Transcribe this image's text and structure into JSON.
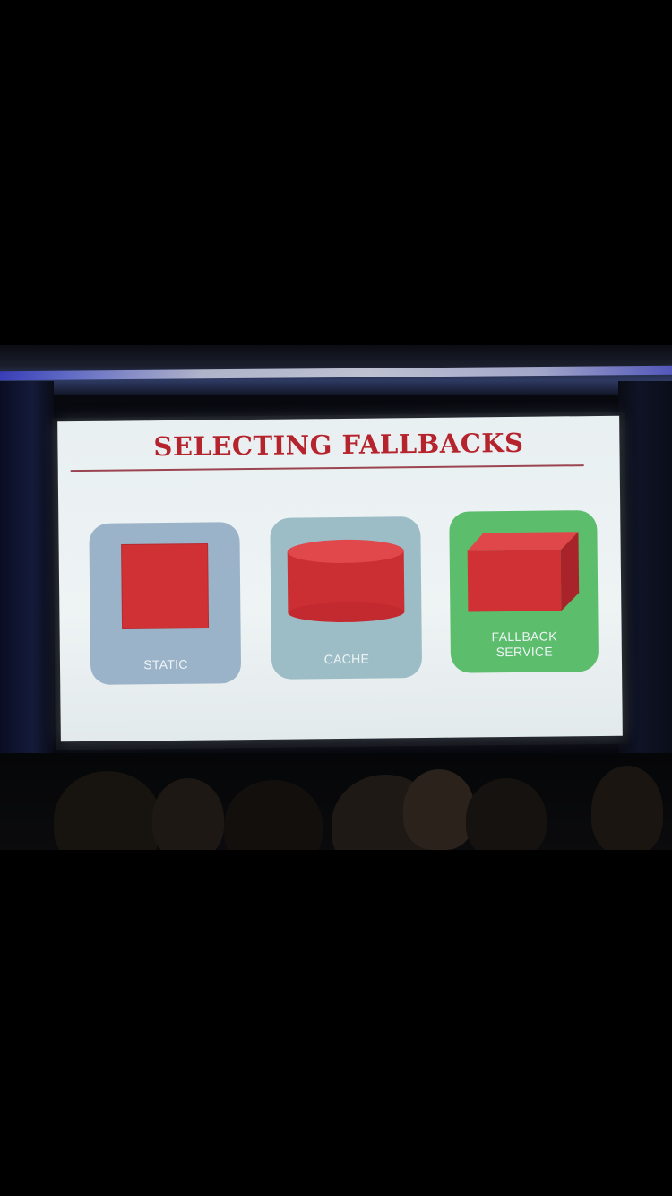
{
  "slide": {
    "title": "SELECTING FALLBACKS",
    "cards": [
      {
        "label": "STATIC",
        "shape": "square-icon",
        "color": "#9bb3c8"
      },
      {
        "label": "CACHE",
        "shape": "cylinder-icon",
        "color": "#9dbdc6"
      },
      {
        "label": "FALLBACK\nSERVICE",
        "shape": "box-icon",
        "color": "#5cbd6c"
      }
    ]
  },
  "colors": {
    "title": "#b5232c",
    "shape_red": "#cf3135",
    "screen": "#eef3f4",
    "background": "#000000"
  }
}
